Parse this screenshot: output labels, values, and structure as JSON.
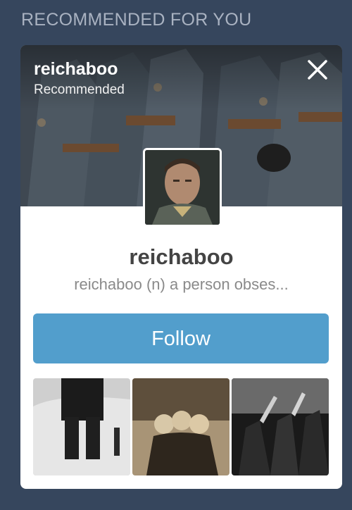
{
  "section": {
    "title": "RECOMMENDED FOR YOU"
  },
  "card": {
    "header": {
      "blog_name": "reichaboo",
      "label": "Recommended",
      "close_icon": "close-icon"
    },
    "blog_name": "reichaboo",
    "description": "reichaboo (n) a person obses...",
    "follow_label": "Follow",
    "thumbnails": [
      {
        "name": "thumbnail-1"
      },
      {
        "name": "thumbnail-2"
      },
      {
        "name": "thumbnail-3"
      }
    ]
  },
  "colors": {
    "background": "#36465d",
    "follow_button": "#529ecc",
    "section_title": "#a9b2c1"
  }
}
